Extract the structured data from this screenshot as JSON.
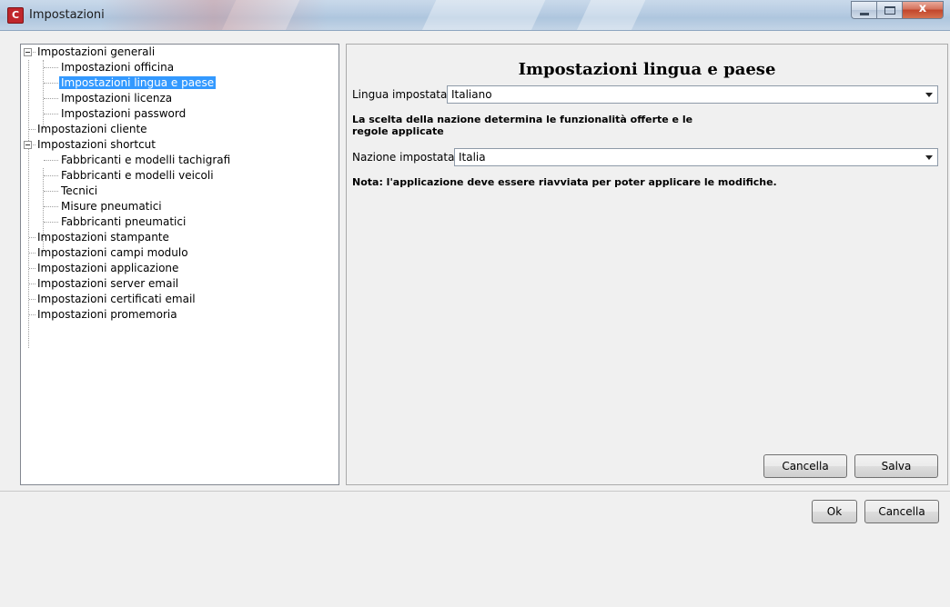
{
  "window": {
    "title": "Impostazioni",
    "app_icon_letter": "C",
    "minimize_icon": "minimize-icon",
    "maximize_icon": "maximize-icon",
    "close_icon": "close-icon",
    "close_glyph": "x"
  },
  "tree": {
    "items": [
      {
        "label": "Impostazioni generali",
        "level": 0,
        "expanded": true
      },
      {
        "label": "Impostazioni officina",
        "level": 1
      },
      {
        "label": "Impostazioni lingua e paese",
        "level": 1,
        "selected": true
      },
      {
        "label": "Impostazioni licenza",
        "level": 1
      },
      {
        "label": "Impostazioni password",
        "level": 1
      },
      {
        "label": "Impostazioni cliente",
        "level": 0
      },
      {
        "label": "Impostazioni shortcut",
        "level": 0,
        "expanded": true
      },
      {
        "label": "Fabbricanti e modelli tachigrafi",
        "level": 1
      },
      {
        "label": "Fabbricanti e modelli veicoli",
        "level": 1
      },
      {
        "label": "Tecnici",
        "level": 1
      },
      {
        "label": "Misure pneumatici",
        "level": 1
      },
      {
        "label": "Fabbricanti pneumatici",
        "level": 1
      },
      {
        "label": "Impostazioni stampante",
        "level": 0
      },
      {
        "label": "Impostazioni campi modulo",
        "level": 0
      },
      {
        "label": "Impostazioni applicazione",
        "level": 0
      },
      {
        "label": "Impostazioni server email",
        "level": 0
      },
      {
        "label": "Impostazioni certificati email",
        "level": 0
      },
      {
        "label": "Impostazioni promemoria",
        "level": 0
      }
    ]
  },
  "panel": {
    "title": "Impostazioni lingua e paese",
    "language_label": "Lingua impostata",
    "language_value": "Italiano",
    "country_info": "La scelta della nazione determina le funzionalità offerte e le regole applicate",
    "country_label": "Nazione impostata",
    "country_value": "Italia",
    "restart_note": "Nota: l'applicazione deve essere riavviata per poter applicare le modifiche.",
    "cancel_label": "Cancella",
    "save_label": "Salva"
  },
  "footer": {
    "ok_label": "Ok",
    "cancel_label": "Cancella"
  },
  "colors": {
    "selection": "#3399ff",
    "app_icon": "#c0262b"
  }
}
